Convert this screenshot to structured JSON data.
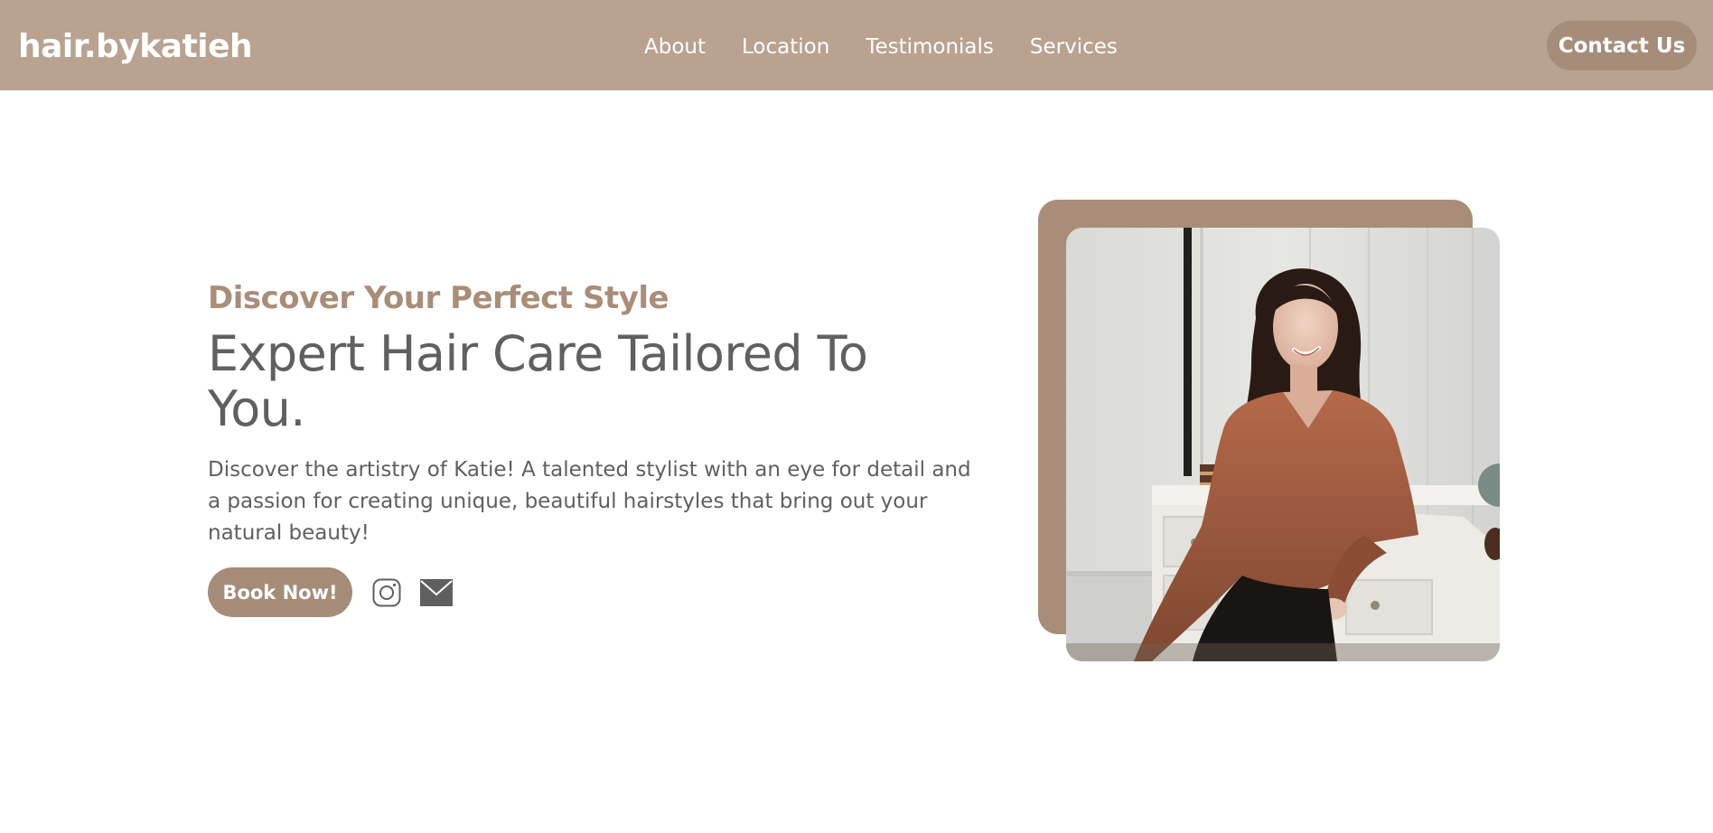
{
  "brand": {
    "logo_text": "hair.bykatieh",
    "colors": {
      "nav_background": "#b9a290",
      "accent": "#a98d78",
      "text_gray": "#606060"
    }
  },
  "nav": {
    "links": [
      {
        "label": "About"
      },
      {
        "label": "Location"
      },
      {
        "label": "Testimonials"
      },
      {
        "label": "Services"
      }
    ],
    "contact_label": "Contact Us"
  },
  "hero": {
    "eyebrow": "Discover Your Perfect Style",
    "headline": "Expert Hair Care Tailored To You.",
    "description": "Discover the artistry of Katie! A talented stylist with an eye for detail and a passion for creating unique, beautiful hairstyles that bring out your natural beauty!",
    "book_label": "Book Now!",
    "social_icons": [
      "instagram-icon",
      "mail-icon"
    ]
  }
}
